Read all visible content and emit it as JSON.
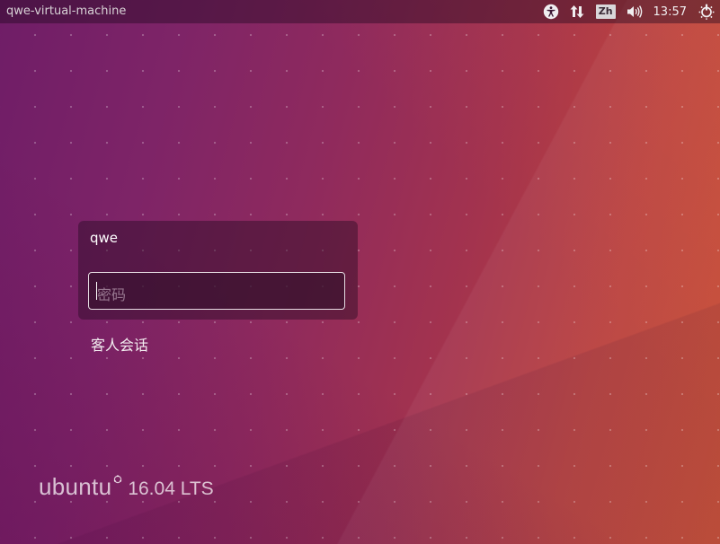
{
  "top_panel": {
    "hostname": "qwe-virtual-machine",
    "keyboard_layout": "Zh",
    "clock": "13:57",
    "icons": [
      "accessibility-icon",
      "network-icon",
      "keyboard-layout-indicator",
      "volume-icon",
      "power-icon"
    ]
  },
  "login": {
    "username": "qwe",
    "password_placeholder": "密码",
    "guest_session_label": "客人会话"
  },
  "branding": {
    "name": "ubuntu",
    "version": "16.04 LTS"
  },
  "colors": {
    "wallpaper_left": "#6f1d67",
    "wallpaper_right": "#c74a2f",
    "panel_text": "#f0eef0"
  }
}
